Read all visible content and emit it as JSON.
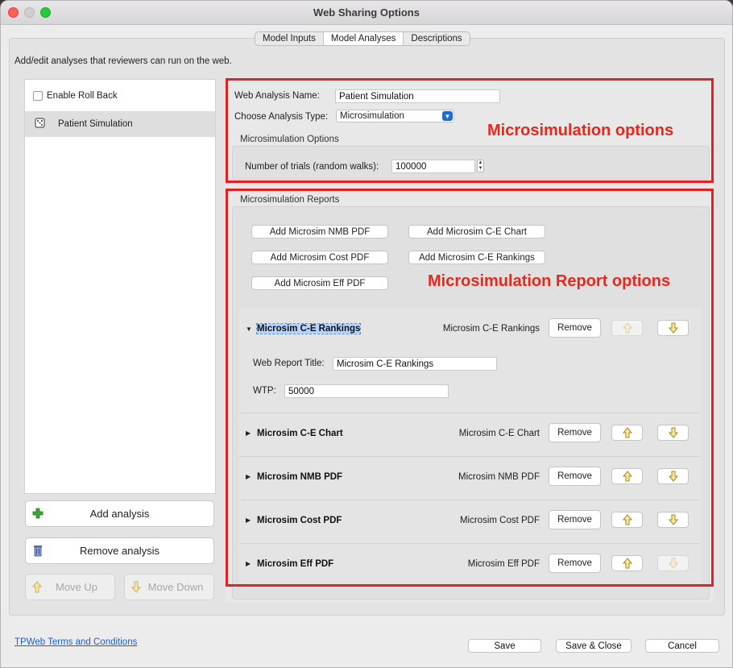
{
  "window": {
    "title": "Web Sharing Options"
  },
  "tabs": [
    {
      "label": "Model Inputs",
      "active": false
    },
    {
      "label": "Model Analyses",
      "active": true
    },
    {
      "label": "Descriptions",
      "active": false
    }
  ],
  "info_text": "Add/edit analyses that reviewers can run on the web.",
  "left_panel": {
    "enable_rollback_label": "Enable Roll Back",
    "enable_rollback_checked": false,
    "items": [
      {
        "label": "Patient Simulation",
        "icon": "dice-icon",
        "selected": true
      }
    ],
    "add_analysis_label": "Add analysis",
    "remove_analysis_label": "Remove analysis",
    "move_up_label": "Move Up",
    "move_down_label": "Move Down"
  },
  "analysis": {
    "name_label": "Web Analysis Name:",
    "name_value": "Patient Simulation",
    "type_label": "Choose Analysis Type:",
    "type_value": "Microsimulation",
    "options_group_title": "Microsimulation Options",
    "trials_label": "Number of trials (random walks):",
    "trials_value": "100000"
  },
  "annotations": {
    "options": "Microsimulation options",
    "report_options": "Microsimulation Report options"
  },
  "reports": {
    "group_title": "Microsimulation Reports",
    "add_buttons": [
      "Add Microsim NMB PDF",
      "Add Microsim C-E Chart",
      "Add Microsim Cost PDF",
      "Add Microsim C-E Rankings",
      "Add Microsim Eff PDF"
    ],
    "remove_label": "Remove",
    "items": [
      {
        "name": "Microsim C-E Rankings",
        "type": "Microsim C-E Rankings",
        "expanded": true,
        "up_enabled": false,
        "down_enabled": true
      },
      {
        "name": "Microsim C-E Chart",
        "type": "Microsim C-E Chart",
        "expanded": false,
        "up_enabled": true,
        "down_enabled": true
      },
      {
        "name": "Microsim NMB PDF",
        "type": "Microsim NMB PDF",
        "expanded": false,
        "up_enabled": true,
        "down_enabled": true
      },
      {
        "name": "Microsim Cost PDF",
        "type": "Microsim Cost PDF",
        "expanded": false,
        "up_enabled": true,
        "down_enabled": true
      },
      {
        "name": "Microsim Eff PDF",
        "type": "Microsim Eff PDF",
        "expanded": false,
        "up_enabled": true,
        "down_enabled": false
      }
    ],
    "expanded_details": {
      "title_label": "Web Report Title:",
      "title_value": "Microsim C-E Rankings",
      "wtp_label": "WTP:",
      "wtp_value": "50000"
    }
  },
  "footer": {
    "terms_link": "TPWeb Terms and Conditions",
    "save_label": "Save",
    "save_close_label": "Save & Close",
    "cancel_label": "Cancel"
  },
  "colors": {
    "accent_blue": "#1a6dd9",
    "annotation_red": "#e62020"
  }
}
